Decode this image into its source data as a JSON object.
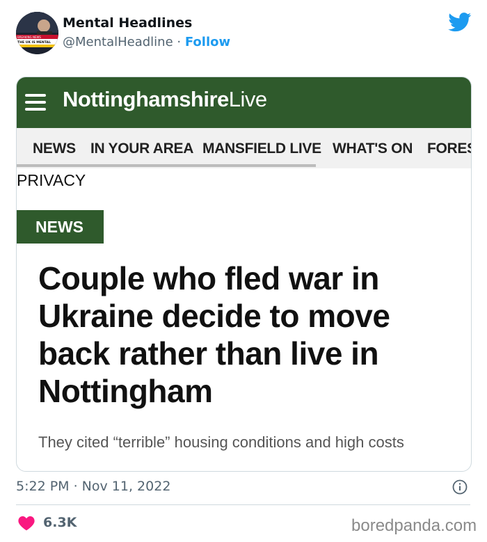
{
  "tweet": {
    "author": {
      "name": "Mental Headlines",
      "handle": "@MentalHeadline",
      "separator": "·",
      "follow_label": "Follow",
      "avatar_banner_top": "BREAKING NEWS",
      "avatar_banner_main": "THE UK IS MENTAL"
    },
    "timestamp": "5:22 PM · Nov 11, 2022",
    "likes": "6.3K",
    "icons": {
      "brand": "twitter-bird-icon",
      "info": "info-icon",
      "like": "heart-icon"
    }
  },
  "article_screenshot": {
    "site_name_bold": "Nottinghamshire",
    "site_name_light": "Live",
    "nav": [
      "NEWS",
      "IN YOUR AREA",
      "MANSFIELD LIVE",
      "WHAT'S ON",
      "FORES"
    ],
    "privacy_label": "PRIVACY",
    "section_tag": "NEWS",
    "headline": "Couple who fled war in Ukraine decide to move back rather than live in Nottingham",
    "subheadline": "They cited “terrible” housing conditions and high costs"
  },
  "watermark": "boredpanda.com",
  "colors": {
    "twitter_blue": "#1d9bf0",
    "site_green": "#2f5a2c",
    "heart_red": "#f91880"
  }
}
